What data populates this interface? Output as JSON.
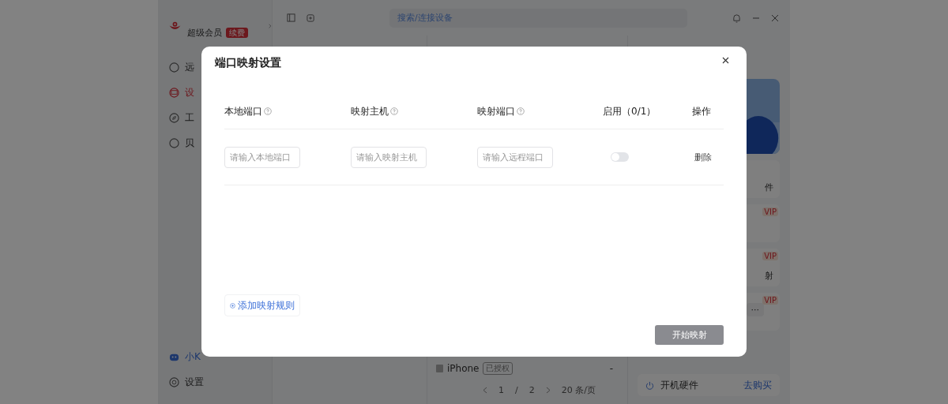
{
  "app": {
    "user": {
      "membership": "超级会员",
      "renew": "续费"
    },
    "sidebar": {
      "items": [
        {
          "label": "远",
          "selected": false
        },
        {
          "label": "设",
          "selected": true
        },
        {
          "label": "工",
          "selected": false
        },
        {
          "label": "贝",
          "selected": false
        }
      ],
      "bottom": [
        {
          "label": "小K"
        },
        {
          "label": "设置"
        }
      ]
    },
    "search": {
      "placeholder": "搜索/连接设备"
    },
    "device_list": {
      "rows": [
        {
          "name": "iPhone",
          "badge": "已授权",
          "column_3": "-"
        }
      ],
      "pagination": {
        "page": "1",
        "separator": "/",
        "total": "2",
        "page_size": "20 条/页"
      }
    },
    "right_panel": {
      "cards": [
        {
          "text": "件"
        },
        {
          "badge": "VIP"
        },
        {
          "text": "射",
          "badge": "VIP"
        },
        {
          "badge": "VIP",
          "more": "···"
        }
      ],
      "hardware": {
        "label": "开机硬件",
        "link": "去购买"
      }
    }
  },
  "dialog": {
    "title": "端口映射设置",
    "columns": [
      {
        "label": "本地端口",
        "help": true
      },
      {
        "label": "映射主机",
        "help": true
      },
      {
        "label": "映射端口",
        "help": true
      },
      {
        "label": "启用（0/1）",
        "help": false
      },
      {
        "label": "操作",
        "help": false
      }
    ],
    "rows": [
      {
        "local_port": {
          "placeholder": "请输入本地端口"
        },
        "host": {
          "placeholder": "请输入映射主机"
        },
        "remote_port": {
          "placeholder": "请输入远程端口"
        },
        "enabled": false,
        "action": "删除"
      }
    ],
    "add_button": "添加映射规则",
    "submit": {
      "label": "开始映射",
      "disabled": true
    }
  }
}
